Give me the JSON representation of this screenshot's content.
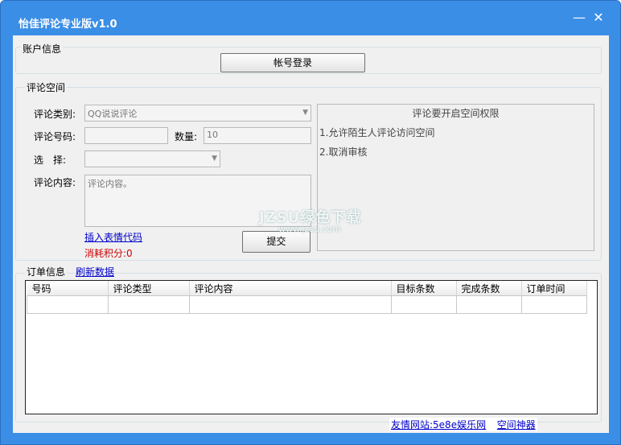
{
  "window": {
    "title": "怡佳评论专业版v1.0"
  },
  "titlebar": {
    "minimize_glyph": "—",
    "close_glyph": "✕"
  },
  "account": {
    "group_label": "账户信息",
    "login_button": "帐号登录"
  },
  "comment": {
    "group_label": "评论空间",
    "type_label": "评论类别:",
    "type_value": "QQ说说评论",
    "number_label": "评论号码:",
    "number_value": "",
    "quantity_label": "数量:",
    "quantity_value": "10",
    "choose_label": "选　择:",
    "choose_value": "",
    "content_label": "评论内容:",
    "content_value": "评论内容。",
    "insert_emoji_link": "插入表情代码",
    "points_text": "消耗积分:0",
    "submit_button": "提交"
  },
  "permission": {
    "title": "评论要开启空间权限",
    "items": [
      "1.允许陌生人评论访问空间",
      "2.取消审核"
    ]
  },
  "orders": {
    "group_label": "订单信息",
    "refresh_link": "刷新数据",
    "columns": [
      "号码",
      "评论类型",
      "评论内容",
      "目标条数",
      "完成条数",
      "订单时间"
    ],
    "rows": [
      [
        "",
        "",
        "",
        "",
        "",
        ""
      ]
    ]
  },
  "footer": {
    "friend_link": "友情网站:5e8e娱乐网",
    "space_tool_link": "空间神器"
  },
  "watermark": {
    "line1": "JZSU绿色下载",
    "line2": "www.jzsu.com"
  },
  "colors": {
    "titlebar": "#3a8ee6",
    "link": "#0000cc",
    "points": "#cc0000"
  }
}
